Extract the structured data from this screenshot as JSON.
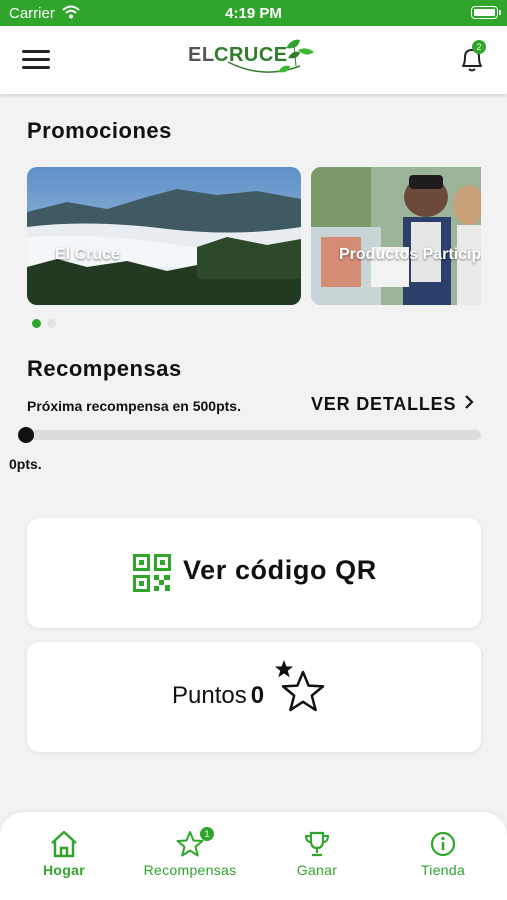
{
  "status_bar": {
    "carrier": "Carrier",
    "time": "4:19 PM"
  },
  "header": {
    "logo_text_a": "EL",
    "logo_text_b": "CRUCE",
    "notification_count": "2"
  },
  "promotions": {
    "title": "Promociones",
    "cards": [
      {
        "caption": "El Cruce"
      },
      {
        "caption": "Productos Particip"
      }
    ],
    "current_page": 1,
    "page_count": 2
  },
  "rewards": {
    "title": "Recompensas",
    "next_reward_text": "Próxima recompensa en 500pts.",
    "details_label": "VER DETALLES",
    "progress_fraction": 0,
    "points_label": "0pts."
  },
  "qr_card": {
    "label": "Ver código QR"
  },
  "points_card": {
    "label": "Puntos",
    "value": "0"
  },
  "tabs": [
    {
      "label": "Hogar",
      "icon": "home-icon",
      "active": true
    },
    {
      "label": "Recompensas",
      "icon": "star-icon",
      "badge": "1"
    },
    {
      "label": "Ganar",
      "icon": "trophy-icon"
    },
    {
      "label": "Tienda",
      "icon": "info-icon"
    }
  ],
  "colors": {
    "brand_green": "#2fa52b",
    "logo_green": "#2f7d2a",
    "background": "#f2f2f2",
    "text_dark": "#111111"
  }
}
